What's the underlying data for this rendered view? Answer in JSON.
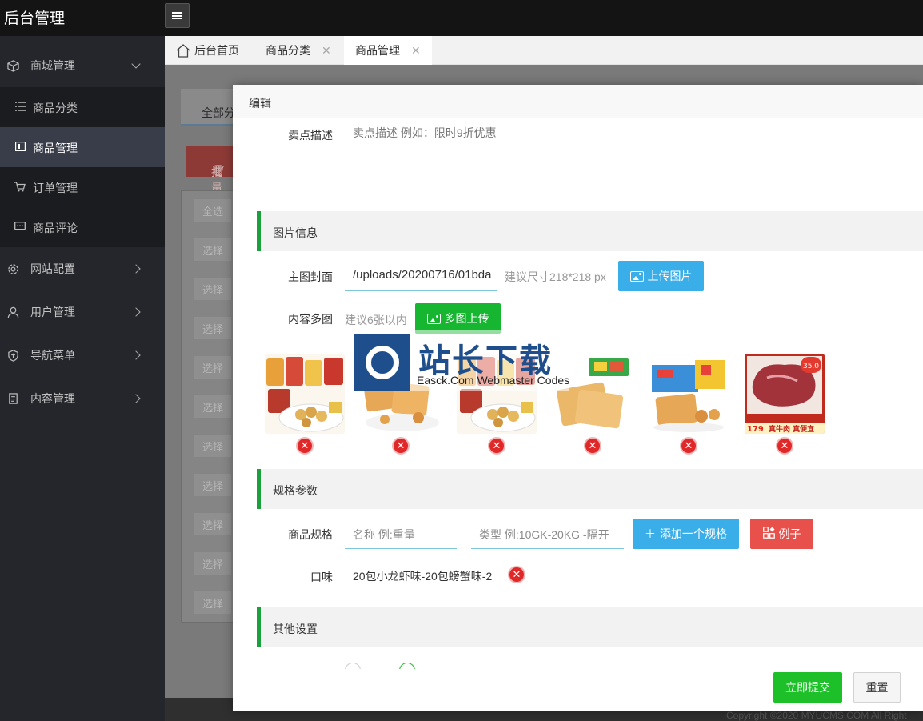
{
  "app": {
    "title": "后台管理"
  },
  "sidebar": {
    "groups": [
      {
        "label": "商城管理",
        "icon": "box-icon",
        "expanded": true
      },
      {
        "label": "网站配置",
        "icon": "gear-icon"
      },
      {
        "label": "用户管理",
        "icon": "user-icon"
      },
      {
        "label": "导航菜单",
        "icon": "shield-icon"
      },
      {
        "label": "内容管理",
        "icon": "file-icon"
      }
    ],
    "sub_items": [
      {
        "label": "商品分类",
        "icon": "list-icon"
      },
      {
        "label": "商品管理",
        "icon": "card-icon",
        "active": true
      },
      {
        "label": "订单管理",
        "icon": "cart-icon"
      },
      {
        "label": "商品评论",
        "icon": "comment-icon"
      }
    ]
  },
  "tabs": [
    {
      "label": "后台首页",
      "icon": "home-icon"
    },
    {
      "label": "商品分类",
      "close": "✕"
    },
    {
      "label": "商品管理",
      "close": "✕",
      "active": true
    }
  ],
  "background": {
    "select_text": "全部分",
    "batch_text": "批量",
    "select_all": "全选",
    "row_select": "选择",
    "copyright": "Copyright ©2020 MYUCMS.COM All Right"
  },
  "modal": {
    "title": "编辑",
    "selling_point": {
      "label": "卖点描述",
      "placeholder": "卖点描述 例如：限时9折优惠"
    },
    "image_section": "图片信息",
    "cover": {
      "label": "主图封面",
      "value": "/uploads/20200716/01bda",
      "hint": "建议尺寸218*218 px",
      "button": "上传图片"
    },
    "gallery": {
      "label": "内容多图",
      "hint": "建议6张以内",
      "button": "多图上传",
      "delete_symbol": "✕",
      "images": [
        "snack-assortment",
        "crackers-1",
        "snack-assortment-2",
        "crackers-2",
        "snack-box",
        "beef-ad"
      ],
      "beef_ad_text": [
        "真牛肉 真便宜",
        "179",
        "35.0"
      ]
    },
    "watermark": {
      "cn": "站长下载",
      "en": "Easck.Com Webmaster Codes"
    },
    "spec_section": "规格参数",
    "spec": {
      "label": "商品规格",
      "name_placeholder": "名称 例:重量",
      "type_placeholder": "类型 例:10GK-20KG -隔开",
      "add_button": "添加一个规格",
      "example_button": "例子"
    },
    "flavor": {
      "label": "口味",
      "value": "20包小龙虾味-20包螃蟹味-2"
    },
    "other_section": "其他设置",
    "submit": "立即提交",
    "reset": "重置"
  },
  "colors": {
    "accent_green": "#16b630",
    "accent_blue": "#3aaee8",
    "danger": "#e8504b",
    "sidebar": "#24262b"
  }
}
